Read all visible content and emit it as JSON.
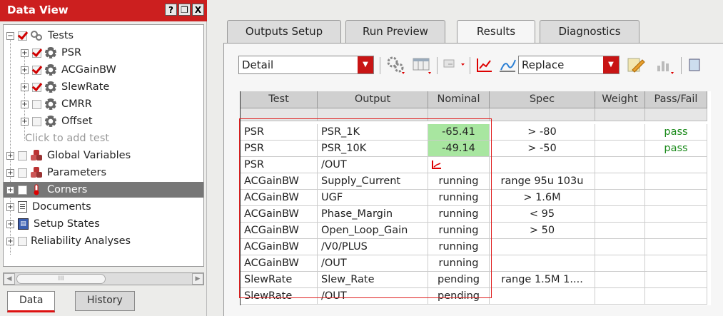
{
  "left_panel": {
    "title": "Data View",
    "title_buttons": [
      "?",
      "❒",
      "X"
    ],
    "tree": {
      "tests": {
        "label": "Tests",
        "children": [
          {
            "label": "PSR",
            "checked": true
          },
          {
            "label": "ACGainBW",
            "checked": true
          },
          {
            "label": "SlewRate",
            "checked": true
          },
          {
            "label": "CMRR",
            "checked": false
          },
          {
            "label": "Offset",
            "checked": false
          }
        ]
      },
      "add_test_placeholder": "Click to add test",
      "global_variables": "Global Variables",
      "parameters": "Parameters",
      "corners": "Corners",
      "documents": "Documents",
      "setup_states": "Setup States",
      "reliability": "Reliability Analyses"
    },
    "scroll_thumb": "III",
    "bottom_tabs": {
      "data": "Data",
      "history": "History"
    }
  },
  "right_panel": {
    "tabs": [
      {
        "label": "Outputs Setup",
        "active": false
      },
      {
        "label": "Run Preview",
        "active": false
      },
      {
        "label": "Results",
        "active": true
      },
      {
        "label": "Diagnostics",
        "active": false
      }
    ],
    "toolbar": {
      "view_select": "Detail",
      "plot_mode_select": "Replace"
    },
    "results_table": {
      "headers": [
        "Test",
        "Output",
        "Nominal",
        "Spec",
        "Weight",
        "Pass/Fail"
      ],
      "rows": [
        {
          "test": "PSR",
          "output": "PSR_1K",
          "nominal": "-65.41",
          "spec": "> -80",
          "weight": "",
          "passfail": "pass",
          "highlight": true
        },
        {
          "test": "PSR",
          "output": "PSR_10K",
          "nominal": "-49.14",
          "spec": "> -50",
          "weight": "",
          "passfail": "pass",
          "highlight": true
        },
        {
          "test": "PSR",
          "output": "/OUT",
          "nominal": "",
          "spec": "",
          "weight": "",
          "passfail": "",
          "wave_icon": true
        },
        {
          "test": "ACGainBW",
          "output": "Supply_Current",
          "nominal": "running",
          "spec": "range 95u 103u",
          "weight": "",
          "passfail": ""
        },
        {
          "test": "ACGainBW",
          "output": "UGF",
          "nominal": "running",
          "spec": "> 1.6M",
          "weight": "",
          "passfail": ""
        },
        {
          "test": "ACGainBW",
          "output": "Phase_Margin",
          "nominal": "running",
          "spec": "< 95",
          "weight": "",
          "passfail": ""
        },
        {
          "test": "ACGainBW",
          "output": "Open_Loop_Gain",
          "nominal": "running",
          "spec": "> 50",
          "weight": "",
          "passfail": ""
        },
        {
          "test": "ACGainBW",
          "output": "/V0/PLUS",
          "nominal": "running",
          "spec": "",
          "weight": "",
          "passfail": ""
        },
        {
          "test": "ACGainBW",
          "output": "/OUT",
          "nominal": "running",
          "spec": "",
          "weight": "",
          "passfail": ""
        },
        {
          "test": "SlewRate",
          "output": "Slew_Rate",
          "nominal": "pending",
          "spec": "range 1.5M 1....",
          "weight": "",
          "passfail": ""
        },
        {
          "test": "SlewRate",
          "output": "/OUT",
          "nominal": "pending",
          "spec": "",
          "weight": "",
          "passfail": ""
        }
      ]
    }
  },
  "colors": {
    "accent_red": "#cc1f1f",
    "pass_green": "#1a8a1a",
    "highlight_green": "#a8e6a0",
    "annotation_box": "#e02020"
  }
}
